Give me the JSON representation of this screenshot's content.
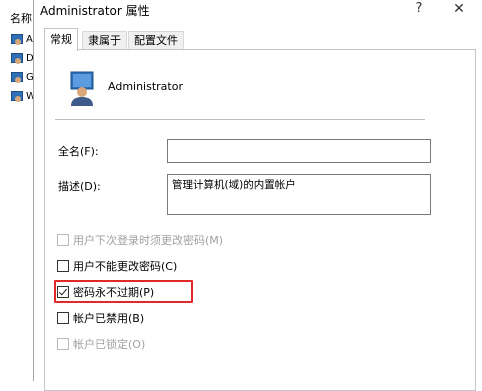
{
  "background_window": {
    "header": "名称",
    "items": [
      {
        "icon": "user-account-icon",
        "char": "A"
      },
      {
        "icon": "user-account-icon",
        "char": "D"
      },
      {
        "icon": "user-account-icon",
        "char": "G"
      },
      {
        "icon": "user-account-icon",
        "char": "W"
      }
    ]
  },
  "dialog": {
    "title": "Administrator 属性",
    "help_label": "?",
    "close_label": "✕",
    "tabs": [
      {
        "label": "常规",
        "active": true
      },
      {
        "label": "隶属于",
        "active": false
      },
      {
        "label": "配置文件",
        "active": false
      }
    ],
    "user": {
      "name": "Administrator",
      "icon": "user-account-icon"
    },
    "fields": {
      "fullname": {
        "label": "全名(F):",
        "value": ""
      },
      "description": {
        "label": "描述(D):",
        "value": "管理计算机(域)的内置帐户"
      }
    },
    "checkboxes": [
      {
        "label": "用户下次登录时须更改密码(M)",
        "checked": false,
        "disabled": true
      },
      {
        "label": "用户不能更改密码(C)",
        "checked": false,
        "disabled": false
      },
      {
        "label": "密码永不过期(P)",
        "checked": true,
        "disabled": false
      },
      {
        "label": "帐户已禁用(B)",
        "checked": false,
        "disabled": false
      },
      {
        "label": "帐户已锁定(O)",
        "checked": false,
        "disabled": true
      }
    ]
  },
  "colors": {
    "highlight": "#e0292b",
    "border": "#c4c4c4"
  }
}
